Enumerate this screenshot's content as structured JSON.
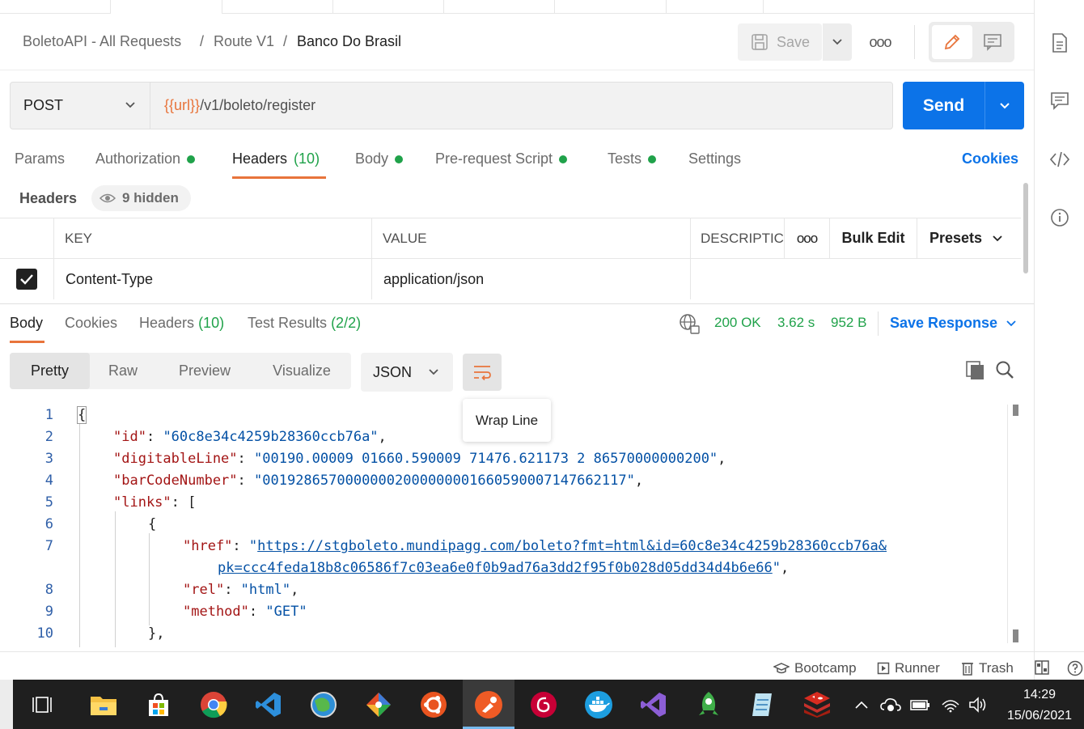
{
  "breadcrumb": {
    "collection": "BoletoAPI - All Requests",
    "folder": "Route V1",
    "request": "Banco Do Brasil",
    "separator": "/"
  },
  "toolbar": {
    "save_label": "Save",
    "more_label": "ooo"
  },
  "request": {
    "method": "POST",
    "url_var": "{{url}}",
    "url_path": "/v1/boleto/register",
    "send_label": "Send"
  },
  "request_tabs": {
    "params": "Params",
    "authorization": "Authorization",
    "headers": "Headers",
    "headers_count": "(10)",
    "body": "Body",
    "prerequest": "Pre-request Script",
    "tests": "Tests",
    "settings": "Settings",
    "cookies": "Cookies"
  },
  "headers_section": {
    "label": "Headers",
    "hidden": "9 hidden",
    "col_key": "KEY",
    "col_value": "VALUE",
    "col_description": "DESCRIPTIC",
    "more": "ooo",
    "bulk_edit": "Bulk Edit",
    "presets": "Presets",
    "row_key": "Content-Type",
    "row_value": "application/json"
  },
  "response_tabs": {
    "body": "Body",
    "cookies": "Cookies",
    "headers": "Headers",
    "headers_count": "(10)",
    "tests": "Test Results",
    "tests_count": "(2/2)"
  },
  "response_status": {
    "status": "200 OK",
    "time": "3.62 s",
    "size": "952 B",
    "save_response": "Save Response"
  },
  "view_modes": {
    "pretty": "Pretty",
    "raw": "Raw",
    "preview": "Preview",
    "visualize": "Visualize",
    "format": "JSON",
    "tooltip": "Wrap Line"
  },
  "code": {
    "line_numbers": [
      "1",
      "2",
      "3",
      "4",
      "5",
      "6",
      "7",
      "8",
      "9",
      "10"
    ],
    "l1": "{",
    "l2_key": "\"id\"",
    "l2_val": "\"60c8e34c4259b28360ccb76a\"",
    "l3_key": "\"digitableLine\"",
    "l3_val": "\"00190.00009 01660.590009 71476.621173 2 86570000000200\"",
    "l4_key": "\"barCodeNumber\"",
    "l4_val": "\"00192865700000002000000001660590007147662117\"",
    "l5_key": "\"links\"",
    "l5_rest": ": [",
    "l6": "{",
    "l7_key": "\"href\"",
    "l7_val_a": "https://stgboleto.mundipagg.com/boleto?fmt=html&id=60c8e34c4259b28360ccb76a&",
    "l7_val_b": "pk=ccc4feda18b8c06586f7c03ea6e0f0b9ad76a3dd2f95f0b028d05dd34d4b6e66",
    "l8_key": "\"rel\"",
    "l8_val": "\"html\"",
    "l9_key": "\"method\"",
    "l9_val": "\"GET\"",
    "l10": "},"
  },
  "statusbar": {
    "bootcamp": "Bootcamp",
    "runner": "Runner",
    "trash": "Trash"
  },
  "taskbar": {
    "time": "14:29",
    "date": "15/06/2021"
  },
  "colors": {
    "accent": "#e8743b",
    "send": "#0c73e8",
    "success": "#20a24a"
  }
}
